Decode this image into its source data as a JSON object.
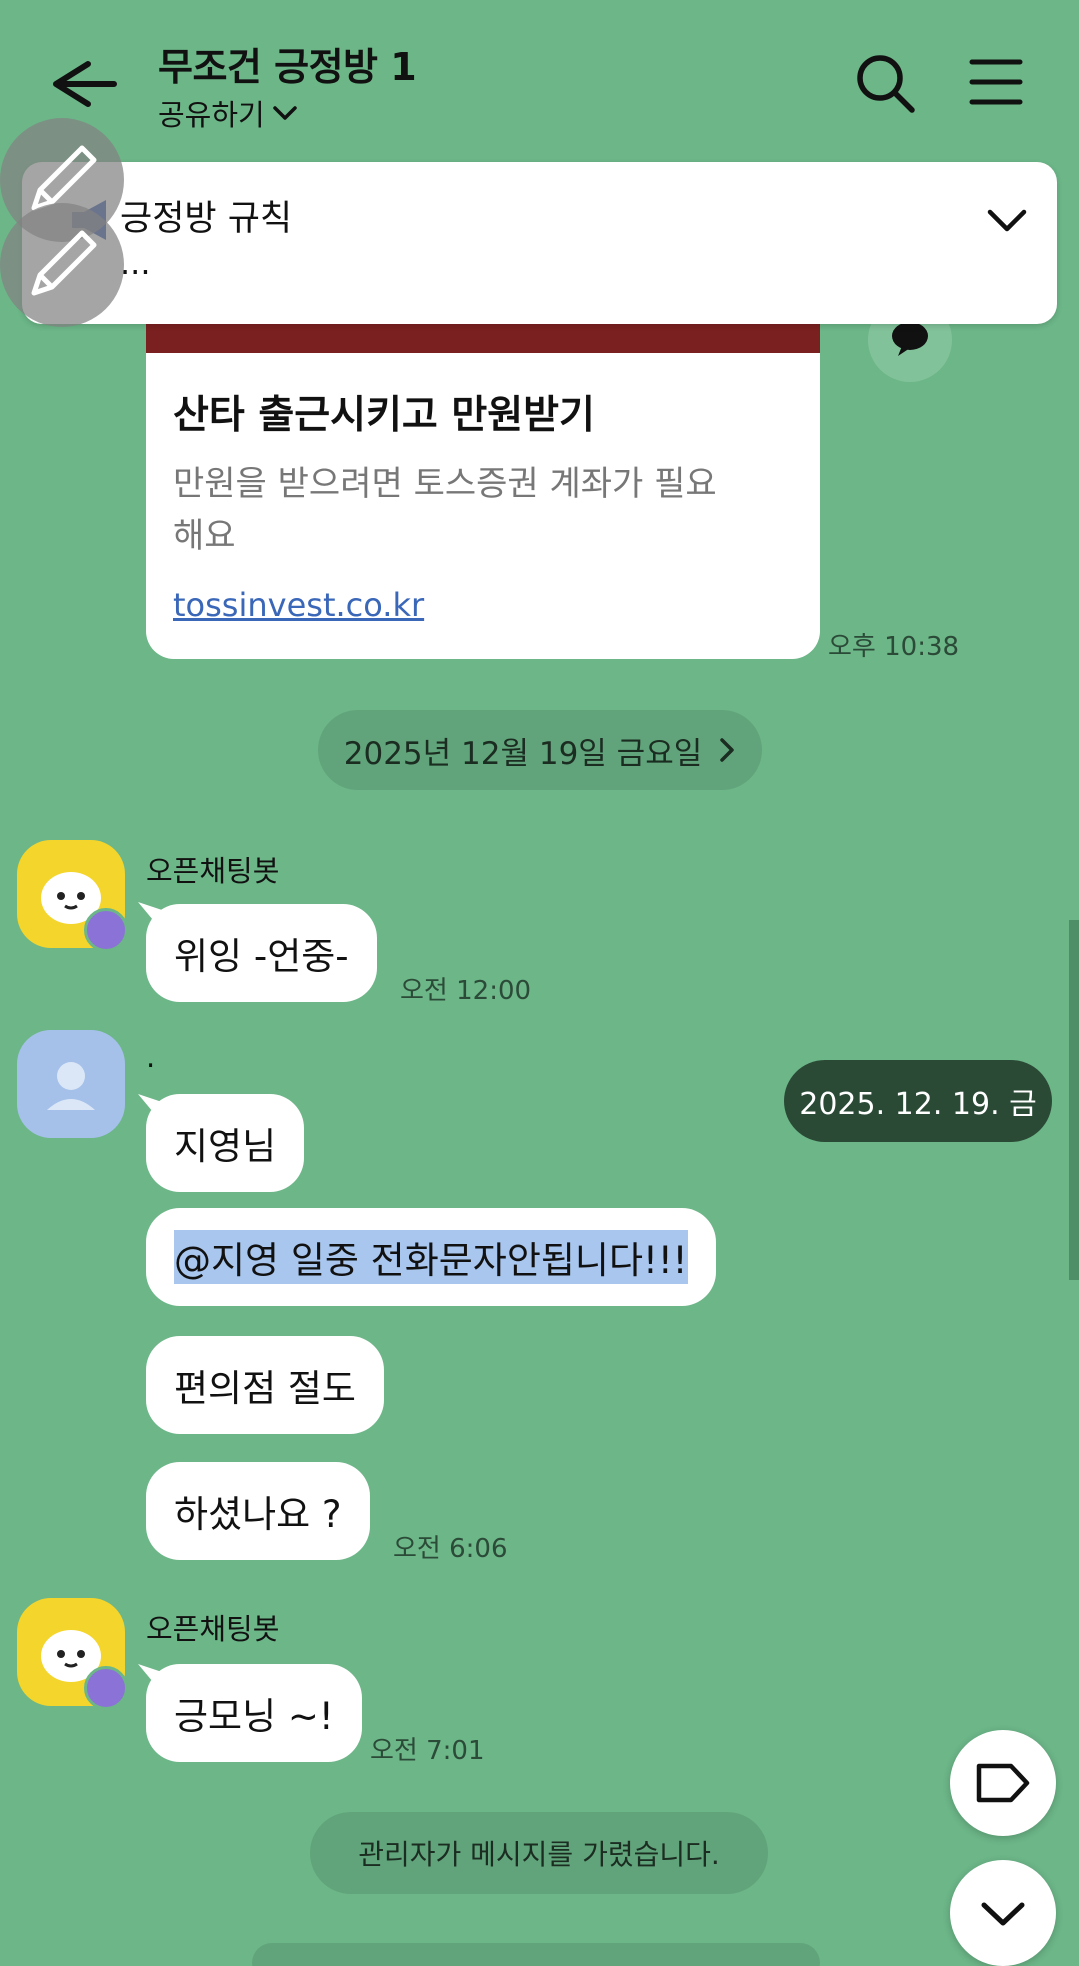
{
  "header": {
    "title": "무조건 긍정방 1",
    "share_label": "공유하기"
  },
  "notice": {
    "title": "긍정방 규칙",
    "subtitle": "..."
  },
  "link_preview": {
    "title": "산타 출근시키고 만원받기",
    "description": "만원을 받으려면 토스증권 계좌가 필요해요",
    "url": "tossinvest.co.kr",
    "time": "오후 10:38"
  },
  "date_divider": "2025년 12월 19일 금요일",
  "messages": [
    {
      "sender": "오픈채팅봇",
      "text": "위잉 -언중-",
      "time": "오전 12:00"
    },
    {
      "sender": ".",
      "texts": [
        "지영님",
        "@지영 일중 전화문자안됩니다!!!",
        "편의점 절도",
        "하셨나요 ?"
      ],
      "time": "오전 6:06"
    },
    {
      "sender": "오픈채팅봇",
      "text": "긍모닝 ~!",
      "time": "오전 7:01"
    }
  ],
  "date_tag": "2025. 12. 19. 금",
  "admin_notice": "관리자가 메시지를 가렸습니다.",
  "colors": {
    "background": "#6cb688",
    "bubble": "#ffffff",
    "bot_avatar": "#f4d52b",
    "user_avatar": "#a5c1ea",
    "date_tag": "#2a4a36"
  }
}
